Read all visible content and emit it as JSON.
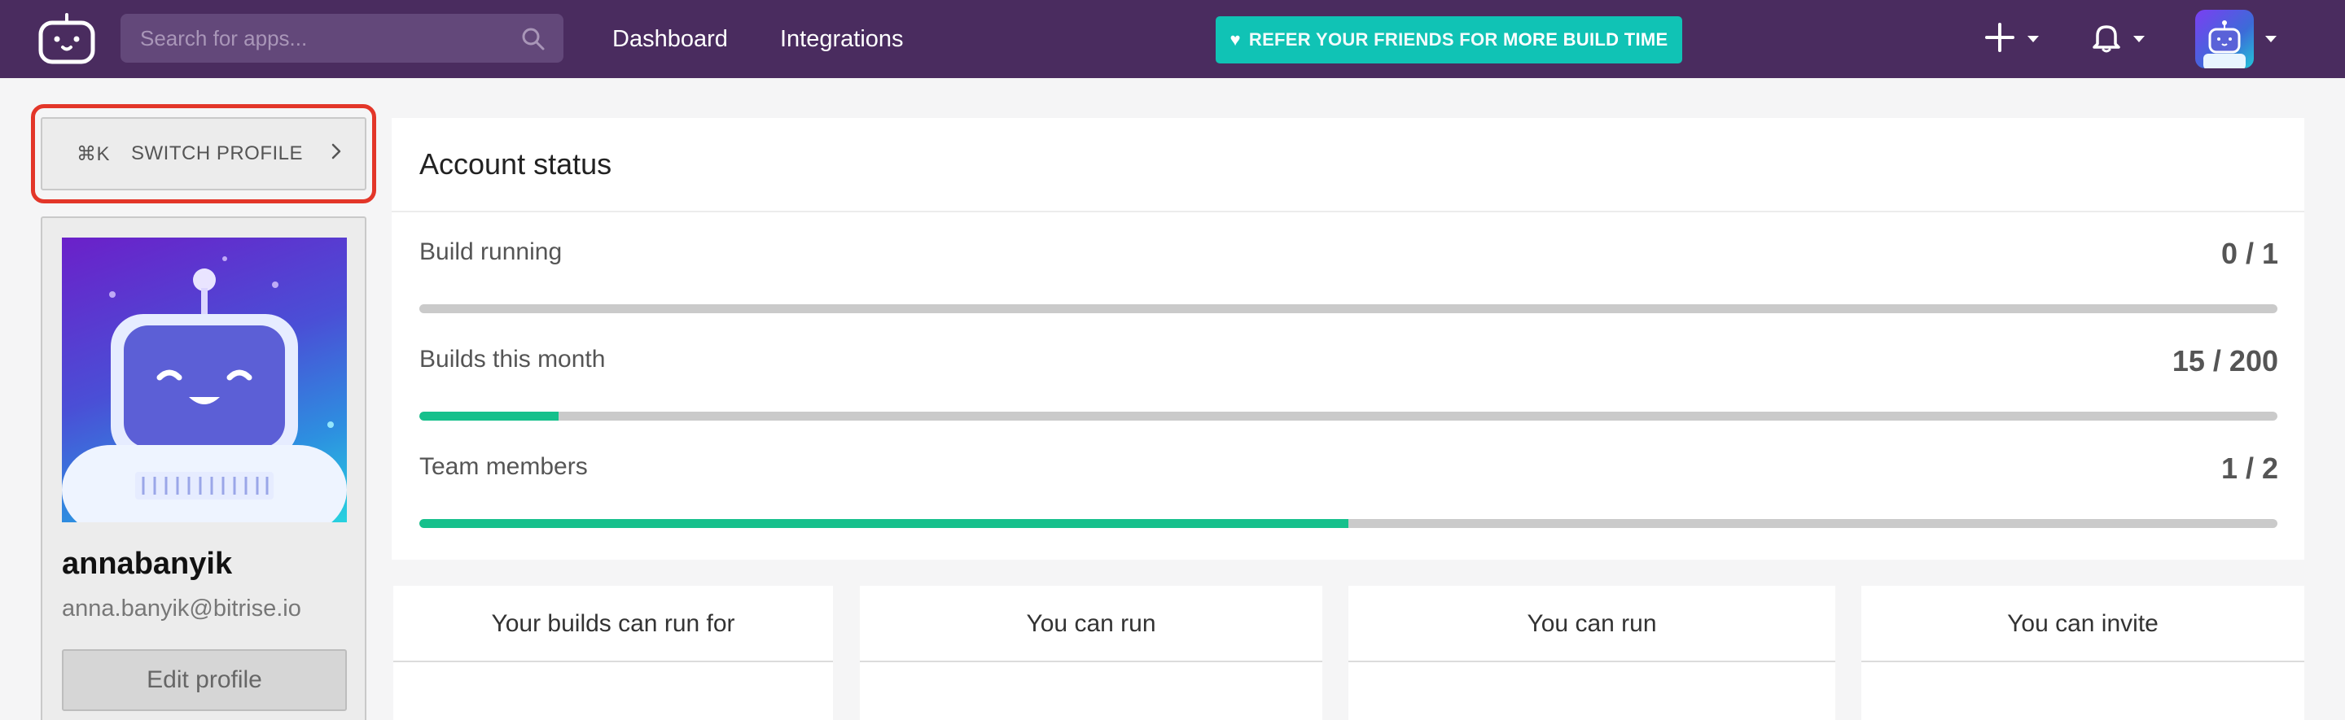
{
  "nav": {
    "search_placeholder": "Search for apps...",
    "links": [
      "Dashboard",
      "Integrations"
    ],
    "refer_prefix": "REFER YOUR FRIENDS FOR",
    "refer_bold": "MORE BUILD TIME"
  },
  "sidebar": {
    "switch_shortcut": "⌘K",
    "switch_label": "SWITCH PROFILE",
    "username": "annabanyik",
    "email": "anna.banyik@bitrise.io",
    "edit_label": "Edit profile"
  },
  "account": {
    "title": "Account status",
    "metrics": [
      {
        "label": "Build running",
        "value": "0 / 1",
        "progress": 0.0
      },
      {
        "label": "Builds this month",
        "value": "15 / 200",
        "progress": 0.075
      },
      {
        "label": "Team members",
        "value": "1 / 2",
        "progress": 0.5
      }
    ]
  },
  "cards": [
    {
      "title": "Your builds can run for",
      "value": "?"
    },
    {
      "title": "You can run",
      "value": "?"
    },
    {
      "title": "You can run",
      "value": "?"
    },
    {
      "title": "You can invite",
      "value": "?"
    }
  ],
  "colors": {
    "nav_bg": "#4a2c5f",
    "refer_bg": "#10c3b5",
    "progress_fill": "#16c08c",
    "highlight": "#e33629"
  }
}
